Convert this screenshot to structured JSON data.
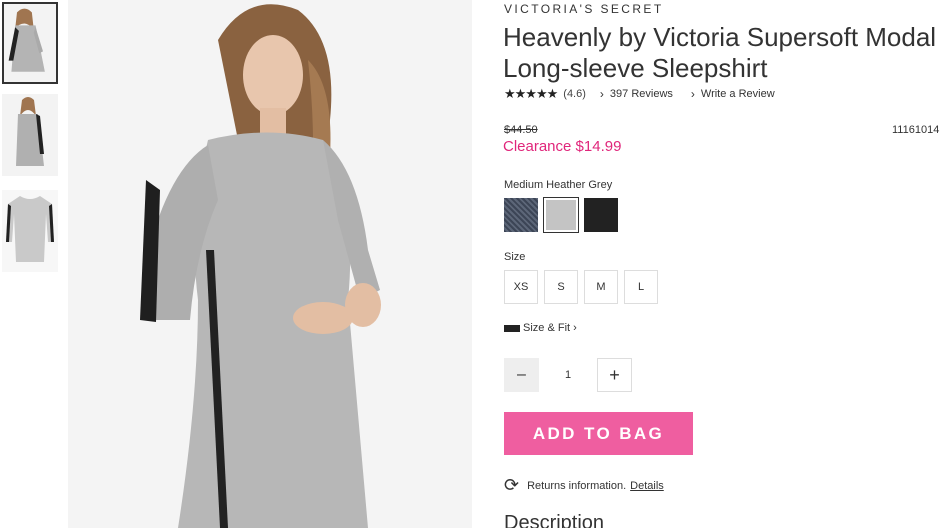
{
  "brand": "VICTORIA'S SECRET",
  "product": {
    "title_line1": "Heavenly by Victoria Supersoft Modal",
    "title_line2": "Long-sleeve Sleepshirt",
    "stars": "★★★★★",
    "rating": "(4.6)",
    "reviews_link": "397 Reviews",
    "write_review_link": "Write a Review",
    "old_price": "$44.50",
    "sale_price": "Clearance $14.99",
    "sku": "11161014"
  },
  "color": {
    "label": "Medium Heather Grey",
    "swatches": [
      {
        "name": "heather-navy",
        "hex": "#4b5566"
      },
      {
        "name": "medium-heather-grey",
        "hex": "#c4c4c4"
      },
      {
        "name": "black",
        "hex": "#222222"
      }
    ],
    "selected_index": 1
  },
  "size": {
    "label": "Size",
    "options": [
      "XS",
      "S",
      "M",
      "L"
    ],
    "size_fit_link": "Size & Fit"
  },
  "quantity": {
    "minus": "–",
    "value": "1",
    "plus": "+"
  },
  "add_to_bag": "ADD TO BAG",
  "returns": {
    "text": "Returns information.",
    "link": "Details",
    "icon": "refresh-icon"
  },
  "description_heading": "Description",
  "colors": {
    "accent": "#ef5ea0",
    "sale": "#e0267b"
  }
}
